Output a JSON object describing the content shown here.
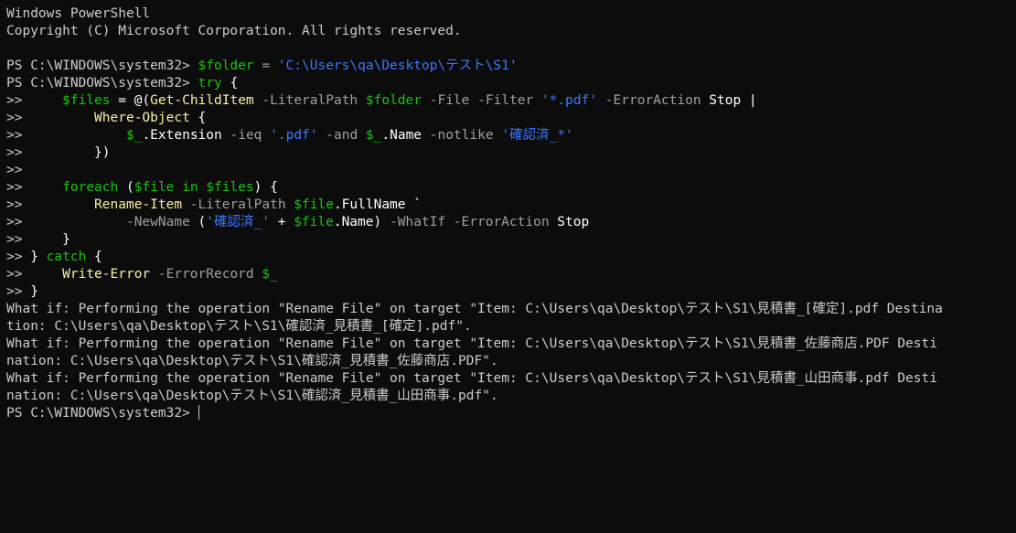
{
  "terminal": {
    "header": [
      "Windows PowerShell",
      "Copyright (C) Microsoft Corporation. All rights reserved."
    ],
    "blank": "",
    "prompt": "PS C:\\WINDOWS\\system32> ",
    "cont": ">> ",
    "l1": {
      "var": "$folder",
      "eq": " = ",
      "str": "'C:\\Users\\qa\\Desktop\\テスト\\S1'"
    },
    "l2": {
      "kw": "try",
      "rest": " {"
    },
    "l3": {
      "indent": "    ",
      "var": "$files",
      "eq": " = @(",
      "cmd": "Get-ChildItem",
      "p1": " -LiteralPath ",
      "v1": "$folder",
      "p2": " -File -Filter ",
      "s1": "'*.pdf'",
      "p3": " -ErrorAction ",
      "t1": "Stop",
      "t2": " |"
    },
    "l4": {
      "indent": "        ",
      "cmd": "Where-Object",
      "rest": " {"
    },
    "l5": {
      "indent": "            ",
      "v1": "$_",
      "t1": ".Extension",
      "p1": " -ieq ",
      "s1": "'.pdf'",
      "p2": " -and ",
      "v2": "$_",
      "t2": ".Name",
      "p3": " -notlike ",
      "s2": "'確認済_*'"
    },
    "l6": {
      "indent": "        ",
      "rest": "})"
    },
    "l7": {
      "indent": ""
    },
    "l8": {
      "indent": "    ",
      "kw1": "foreach",
      "t1": " (",
      "v1": "$file",
      "kw2": " in ",
      "v2": "$files",
      "t2": ") {"
    },
    "l9": {
      "indent": "        ",
      "cmd": "Rename-Item",
      "p1": " -LiteralPath ",
      "v1": "$file",
      "t1": ".FullName `"
    },
    "l10": {
      "indent": "            ",
      "p1": "-NewName",
      "t1": " (",
      "s1": "'確認済_'",
      "t2": " + ",
      "v1": "$file",
      "t3": ".Name)",
      "p2": " -WhatIf -ErrorAction ",
      "t4": "Stop"
    },
    "l11": {
      "indent": "    ",
      "rest": "}"
    },
    "l12": {
      "t1": "} ",
      "kw": "catch",
      "rest": " {"
    },
    "l13": {
      "indent": "    ",
      "cmd": "Write-Error",
      "p1": " -ErrorRecord ",
      "v1": "$_"
    },
    "l14": {
      "rest": "}"
    },
    "output": [
      "What if: Performing the operation \"Rename File\" on target \"Item: C:\\Users\\qa\\Desktop\\テスト\\S1\\見積書_[確定].pdf Destina",
      "tion: C:\\Users\\qa\\Desktop\\テスト\\S1\\確認済_見積書_[確定].pdf\".",
      "What if: Performing the operation \"Rename File\" on target \"Item: C:\\Users\\qa\\Desktop\\テスト\\S1\\見積書_佐藤商店.PDF Desti",
      "nation: C:\\Users\\qa\\Desktop\\テスト\\S1\\確認済_見積書_佐藤商店.PDF\".",
      "What if: Performing the operation \"Rename File\" on target \"Item: C:\\Users\\qa\\Desktop\\テスト\\S1\\見積書_山田商事.pdf Desti",
      "nation: C:\\Users\\qa\\Desktop\\テスト\\S1\\確認済_見積書_山田商事.pdf\"."
    ]
  }
}
